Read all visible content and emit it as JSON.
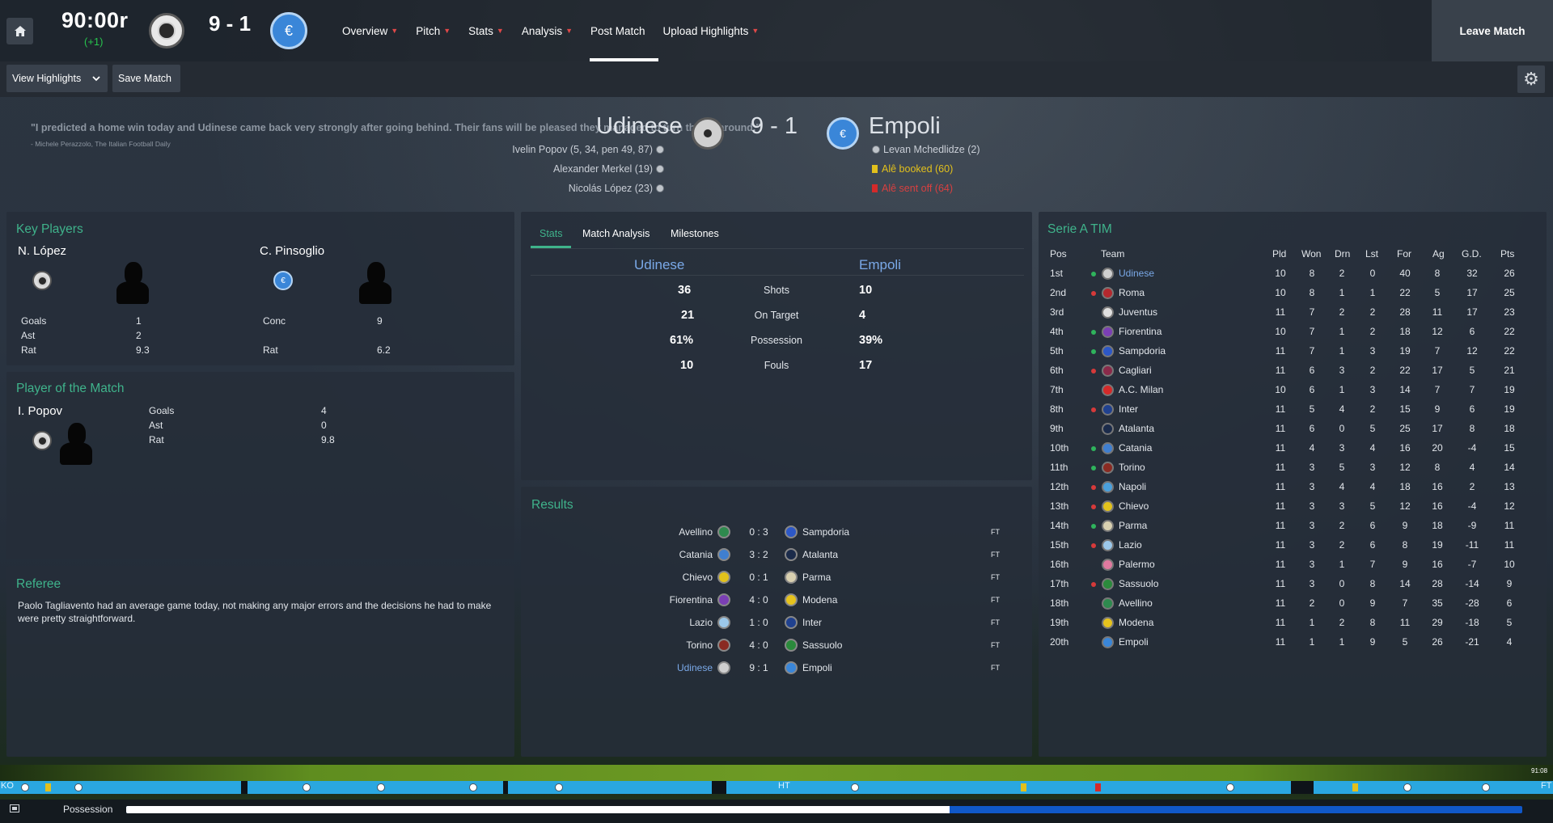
{
  "topbar": {
    "clock": "90:00r",
    "added_time": "(+1)",
    "score": "9 - 1",
    "nav": [
      {
        "label": "Overview",
        "has_menu": true
      },
      {
        "label": "Pitch",
        "has_menu": true
      },
      {
        "label": "Stats",
        "has_menu": true
      },
      {
        "label": "Analysis",
        "has_menu": true
      },
      {
        "label": "Post Match",
        "has_menu": false,
        "active": true
      },
      {
        "label": "Upload Highlights",
        "has_menu": true
      }
    ],
    "leave_label": "Leave Match"
  },
  "toolbar": {
    "view_highlights": "View Highlights",
    "save_match": "Save Match"
  },
  "header": {
    "quote": "\"I predicted a home win today and Udinese came back very strongly after going behind. Their fans will be pleased they managed to turn things around.\"",
    "quote_source": "- Michele Perazzolo, The Italian Football Daily",
    "home_team": "Udinese",
    "away_team": "Empoli",
    "score": "9 - 1",
    "home_events": [
      "Ivelin Popov (5, 34, pen 49, 87)",
      "Alexander Merkel (19)",
      "Nicolás López (23)"
    ],
    "away_events": [
      {
        "text": "Levan Mchedlidze (2)",
        "type": "goal"
      },
      {
        "text": "Alê booked (60)",
        "type": "yellow"
      },
      {
        "text": "Alê sent off (64)",
        "type": "red"
      }
    ]
  },
  "key_players": {
    "title": "Key Players",
    "home": {
      "name": "N. López",
      "rows": [
        {
          "label": "Goals",
          "value": "1"
        },
        {
          "label": "Ast",
          "value": "2"
        },
        {
          "label": "Rat",
          "value": "9.3"
        }
      ]
    },
    "away": {
      "name": "C. Pinsoglio",
      "rows": [
        {
          "label": "Conc",
          "value": "9"
        },
        {
          "label": "Rat",
          "value": "6.2"
        }
      ]
    }
  },
  "potm": {
    "title": "Player of the Match",
    "name": "I. Popov",
    "rows": [
      {
        "label": "Goals",
        "value": "4"
      },
      {
        "label": "Ast",
        "value": "0"
      },
      {
        "label": "Rat",
        "value": "9.8"
      }
    ]
  },
  "referee": {
    "title": "Referee",
    "text": "Paolo Tagliavento had an average game today, not making any major errors and the decisions he had to make were pretty straightforward."
  },
  "stats": {
    "tabs": [
      "Stats",
      "Match Analysis",
      "Milestones"
    ],
    "home": "Udinese",
    "away": "Empoli",
    "rows": [
      {
        "label": "Shots",
        "home": "36",
        "away": "10"
      },
      {
        "label": "On Target",
        "home": "21",
        "away": "4"
      },
      {
        "label": "Possession",
        "home": "61%",
        "away": "39%"
      },
      {
        "label": "Fouls",
        "home": "10",
        "away": "17"
      }
    ]
  },
  "results": {
    "title": "Results",
    "rows": [
      {
        "home": "Avellino",
        "score": "0 : 3",
        "away": "Sampdoria",
        "status": "FT",
        "hc": "#2e8a4e",
        "ac": "#2d58c7"
      },
      {
        "home": "Catania",
        "score": "3 : 2",
        "away": "Atalanta",
        "status": "FT",
        "hc": "#3f7fd0",
        "ac": "#1b2b4a"
      },
      {
        "home": "Chievo",
        "score": "0 : 1",
        "away": "Parma",
        "status": "FT",
        "hc": "#e2c21c",
        "ac": "#d8d0b0"
      },
      {
        "home": "Fiorentina",
        "score": "4 : 0",
        "away": "Modena",
        "status": "FT",
        "hc": "#7b3fb5",
        "ac": "#e6c31d"
      },
      {
        "home": "Lazio",
        "score": "1 : 0",
        "away": "Inter",
        "status": "FT",
        "hc": "#9cc8ea",
        "ac": "#20418f"
      },
      {
        "home": "Torino",
        "score": "4 : 0",
        "away": "Sassuolo",
        "status": "FT",
        "hc": "#8a2a22",
        "ac": "#2b8a3c"
      },
      {
        "home": "Udinese",
        "score": "9 : 1",
        "away": "Empoli",
        "status": "FT",
        "hc": "#cfcfcf",
        "ac": "#3a86d8",
        "highlight": true
      }
    ]
  },
  "league": {
    "title": "Serie A TIM",
    "headers": [
      "Pos",
      "Team",
      "Pld",
      "Won",
      "Drn",
      "Lst",
      "For",
      "Ag",
      "G.D.",
      "Pts"
    ],
    "rows": [
      {
        "pos": "1st",
        "move": "up",
        "team": "Udinese",
        "color": "#cfcfcf",
        "pld": "10",
        "won": "8",
        "drn": "2",
        "lst": "0",
        "for": "40",
        "ag": "8",
        "gd": "32",
        "pts": "26",
        "highlight": true
      },
      {
        "pos": "2nd",
        "move": "down",
        "team": "Roma",
        "color": "#b4282e",
        "pld": "10",
        "won": "8",
        "drn": "1",
        "lst": "1",
        "for": "22",
        "ag": "5",
        "gd": "17",
        "pts": "25"
      },
      {
        "pos": "3rd",
        "move": "",
        "team": "Juventus",
        "color": "#e0e0e0",
        "pld": "11",
        "won": "7",
        "drn": "2",
        "lst": "2",
        "for": "28",
        "ag": "11",
        "gd": "17",
        "pts": "23"
      },
      {
        "pos": "4th",
        "move": "up",
        "team": "Fiorentina",
        "color": "#7b3fb5",
        "pld": "10",
        "won": "7",
        "drn": "1",
        "lst": "2",
        "for": "18",
        "ag": "12",
        "gd": "6",
        "pts": "22"
      },
      {
        "pos": "5th",
        "move": "up",
        "team": "Sampdoria",
        "color": "#2d58c7",
        "pld": "11",
        "won": "7",
        "drn": "1",
        "lst": "3",
        "for": "19",
        "ag": "7",
        "gd": "12",
        "pts": "22"
      },
      {
        "pos": "6th",
        "move": "down",
        "team": "Cagliari",
        "color": "#8a2a4a",
        "pld": "11",
        "won": "6",
        "drn": "3",
        "lst": "2",
        "for": "22",
        "ag": "17",
        "gd": "5",
        "pts": "21"
      },
      {
        "pos": "7th",
        "move": "",
        "team": "A.C. Milan",
        "color": "#d42a2a",
        "pld": "10",
        "won": "6",
        "drn": "1",
        "lst": "3",
        "for": "14",
        "ag": "7",
        "gd": "7",
        "pts": "19"
      },
      {
        "pos": "8th",
        "move": "down",
        "team": "Inter",
        "color": "#20418f",
        "pld": "11",
        "won": "5",
        "drn": "4",
        "lst": "2",
        "for": "15",
        "ag": "9",
        "gd": "6",
        "pts": "19"
      },
      {
        "pos": "9th",
        "move": "",
        "team": "Atalanta",
        "color": "#1b2b4a",
        "pld": "11",
        "won": "6",
        "drn": "0",
        "lst": "5",
        "for": "25",
        "ag": "17",
        "gd": "8",
        "pts": "18"
      },
      {
        "pos": "10th",
        "move": "up",
        "team": "Catania",
        "color": "#3f7fd0",
        "pld": "11",
        "won": "4",
        "drn": "3",
        "lst": "4",
        "for": "16",
        "ag": "20",
        "gd": "-4",
        "pts": "15"
      },
      {
        "pos": "11th",
        "move": "up",
        "team": "Torino",
        "color": "#8a2a22",
        "pld": "11",
        "won": "3",
        "drn": "5",
        "lst": "3",
        "for": "12",
        "ag": "8",
        "gd": "4",
        "pts": "14"
      },
      {
        "pos": "12th",
        "move": "down",
        "team": "Napoli",
        "color": "#4aa0dd",
        "pld": "11",
        "won": "3",
        "drn": "4",
        "lst": "4",
        "for": "18",
        "ag": "16",
        "gd": "2",
        "pts": "13"
      },
      {
        "pos": "13th",
        "move": "down",
        "team": "Chievo",
        "color": "#e2c21c",
        "pld": "11",
        "won": "3",
        "drn": "3",
        "lst": "5",
        "for": "12",
        "ag": "16",
        "gd": "-4",
        "pts": "12"
      },
      {
        "pos": "14th",
        "move": "up",
        "team": "Parma",
        "color": "#d8d0b0",
        "pld": "11",
        "won": "3",
        "drn": "2",
        "lst": "6",
        "for": "9",
        "ag": "18",
        "gd": "-9",
        "pts": "11"
      },
      {
        "pos": "15th",
        "move": "down",
        "team": "Lazio",
        "color": "#9cc8ea",
        "pld": "11",
        "won": "3",
        "drn": "2",
        "lst": "6",
        "for": "8",
        "ag": "19",
        "gd": "-11",
        "pts": "11"
      },
      {
        "pos": "16th",
        "move": "",
        "team": "Palermo",
        "color": "#e07aa0",
        "pld": "11",
        "won": "3",
        "drn": "1",
        "lst": "7",
        "for": "9",
        "ag": "16",
        "gd": "-7",
        "pts": "10"
      },
      {
        "pos": "17th",
        "move": "down",
        "team": "Sassuolo",
        "color": "#2b8a3c",
        "pld": "11",
        "won": "3",
        "drn": "0",
        "lst": "8",
        "for": "14",
        "ag": "28",
        "gd": "-14",
        "pts": "9"
      },
      {
        "pos": "18th",
        "move": "",
        "team": "Avellino",
        "color": "#2e8a4e",
        "pld": "11",
        "won": "2",
        "drn": "0",
        "lst": "9",
        "for": "7",
        "ag": "35",
        "gd": "-28",
        "pts": "6"
      },
      {
        "pos": "19th",
        "move": "",
        "team": "Modena",
        "color": "#e6c31d",
        "pld": "11",
        "won": "1",
        "drn": "2",
        "lst": "8",
        "for": "11",
        "ag": "29",
        "gd": "-18",
        "pts": "5"
      },
      {
        "pos": "20th",
        "move": "",
        "team": "Empoli",
        "color": "#3a86d8",
        "pld": "11",
        "won": "1",
        "drn": "1",
        "lst": "9",
        "for": "5",
        "ag": "26",
        "gd": "-21",
        "pts": "4"
      }
    ]
  },
  "timeline": {
    "ko_label": "KO",
    "ht_label": "HT",
    "ft_label": "FT",
    "time_badge": "91:08",
    "possession_label": "Possession",
    "home_possession_pct": 61
  },
  "colors": {
    "accent": "#3fb38b",
    "home_link": "#7aa9e8",
    "away_card_red": "#d42a2a",
    "away_card_yellow": "#e2c01c"
  }
}
